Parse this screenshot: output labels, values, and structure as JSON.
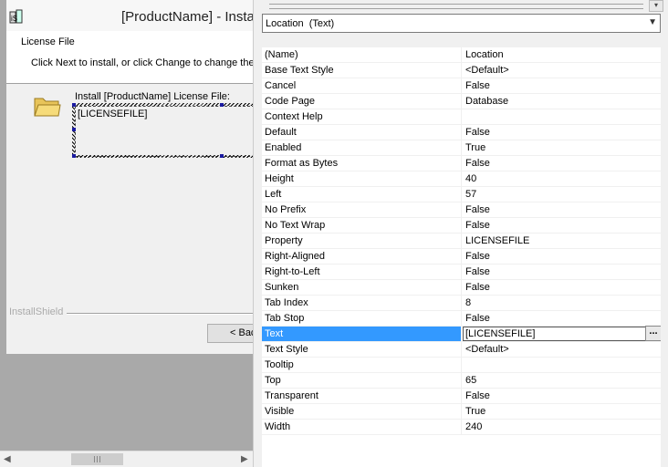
{
  "designer": {
    "title": "[ProductName] - Insta",
    "header_title": "License File",
    "header_desc": "Click Next to install, or click Change to change the",
    "install_label": "Install [ProductName] License File:",
    "license_field": "[LICENSEFILE]",
    "branding": "InstallShield",
    "back_button": "< Bac"
  },
  "properties": {
    "object_selector": "Location  (Text)",
    "ellipsis": "...",
    "rows": [
      {
        "name": "(Name)",
        "value": "Location"
      },
      {
        "name": "Base Text Style",
        "value": "<Default>"
      },
      {
        "name": "Cancel",
        "value": "False"
      },
      {
        "name": "Code Page",
        "value": "Database"
      },
      {
        "name": "Context Help",
        "value": ""
      },
      {
        "name": "Default",
        "value": "False"
      },
      {
        "name": "Enabled",
        "value": "True"
      },
      {
        "name": "Format as Bytes",
        "value": "False"
      },
      {
        "name": "Height",
        "value": "40"
      },
      {
        "name": "Left",
        "value": "57"
      },
      {
        "name": "No Prefix",
        "value": "False"
      },
      {
        "name": "No Text Wrap",
        "value": "False"
      },
      {
        "name": "Property",
        "value": "LICENSEFILE"
      },
      {
        "name": "Right-Aligned",
        "value": "False"
      },
      {
        "name": "Right-to-Left",
        "value": "False"
      },
      {
        "name": "Sunken",
        "value": "False"
      },
      {
        "name": "Tab Index",
        "value": "8"
      },
      {
        "name": "Tab Stop",
        "value": "False"
      },
      {
        "name": "Text",
        "value": "[LICENSEFILE]",
        "selected": true
      },
      {
        "name": "Text Style",
        "value": "<Default>"
      },
      {
        "name": "Tooltip",
        "value": ""
      },
      {
        "name": "Top",
        "value": "65"
      },
      {
        "name": "Transparent",
        "value": "False"
      },
      {
        "name": "Visible",
        "value": "True"
      },
      {
        "name": "Width",
        "value": "240"
      }
    ]
  },
  "colors": {
    "selection": "#3399ff",
    "designer_background": "#a9a9a9"
  },
  "icons": [
    "installshield-app-icon",
    "folder-icon",
    "chevron-down-icon",
    "scroll-left-icon",
    "scroll-right-icon"
  ]
}
